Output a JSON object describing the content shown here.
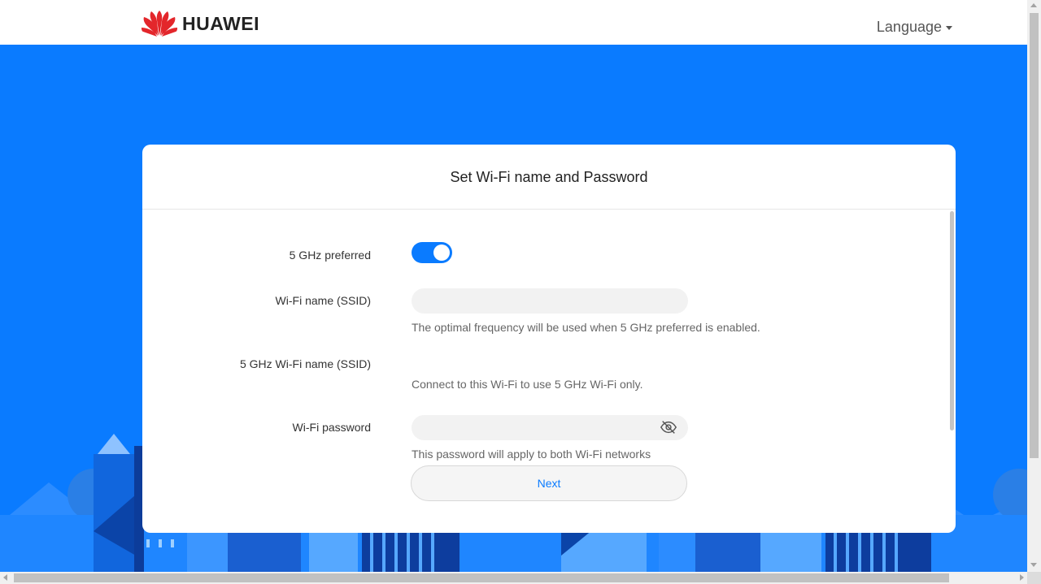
{
  "header": {
    "brand": "HUAWEI",
    "language_label": "Language"
  },
  "colors": {
    "accent": "#0a7bff",
    "brand_red": "#e3262b"
  },
  "card": {
    "title": "Set Wi-Fi name and Password",
    "preferred_5ghz": {
      "label": "5 GHz preferred",
      "enabled": true
    },
    "ssid": {
      "label": "Wi-Fi name (SSID)",
      "value": "",
      "hint": "The optimal frequency will be used when 5 GHz preferred is enabled."
    },
    "ssid_5ghz": {
      "label": "5 GHz Wi-Fi name (SSID)",
      "value": "",
      "hint": "Connect to this Wi-Fi to use 5 GHz Wi-Fi only."
    },
    "password": {
      "label": "Wi-Fi password",
      "value": "",
      "hint": "This password will apply to both Wi-Fi networks",
      "visibility_icon": "eye-slash-icon"
    },
    "next_label": "Next"
  }
}
